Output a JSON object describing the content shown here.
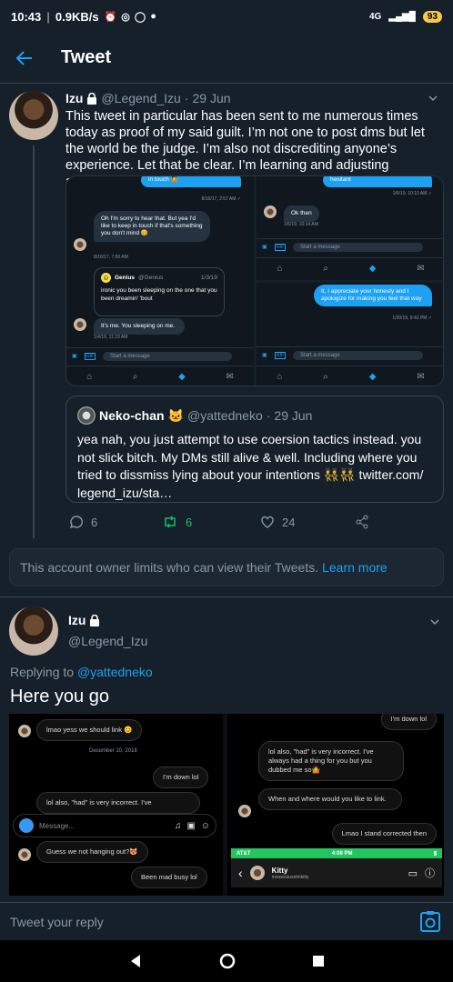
{
  "status_bar": {
    "time": "10:43",
    "speed": "0.9KB/s",
    "battery": "93",
    "network": "4G"
  },
  "app_bar": {
    "title": "Tweet"
  },
  "tweet": {
    "name": "Izu",
    "handle": "@Legend_Izu",
    "dot": "·",
    "date": "29 Jun",
    "text": "This tweet in particular has been sent to me numerous times today as proof of my said guilt. I’m not one to post dms but let the world be the judge. I’m also not discrediting anyone’s experience. Let that be clear. I’m learning and adjusting accordingly",
    "media": {
      "panel1": {
        "bubble_top": "in touch 🤷",
        "time1": "8/16/17, 2:57 AM ✓",
        "gray1": "Oh I'm sorry to hear that. But yea I'd like to keep in touch if that's something you don't mind 😊",
        "time2": "8/16/17, 7:50 AM",
        "genius_name": "Genius",
        "genius_handle": "@Genius",
        "genius_date": "1/3/19",
        "genius_text": "ironic you been sleeping on the one that you been dreamin' 'bout",
        "gray2": "It's me. You sleeping on me.",
        "time3": "1/4/19, 11:23 AM",
        "compose": "Start a message"
      },
      "panel2": {
        "bubble_top": "hesitant",
        "time1": "1/6/19, 10:10 AM ✓",
        "gray1": "Ok then",
        "time2": "1/6/19, 10:14 AM",
        "compose": "Start a message"
      },
      "panel3": {
        "blue": "It, I appreciate your honesty and I apologize for making you feel that way",
        "time1": "1/20/19, 8:42 PM ✓",
        "compose": "Start a message"
      }
    },
    "quote": {
      "name": "Neko-chan",
      "emoji": "🐱",
      "handle": "@yattedneko",
      "dot": "·",
      "date": "29 Jun",
      "text": "yea nah, you just attempt to use coersion tactics instead. you not slick bitch. My DMs still alive & well. Including where you tried to dissmiss lying about your intentions 👯👯 twitter.com/ legend_izu/sta…"
    },
    "actions": {
      "replies": "6",
      "retweets": "6",
      "likes": "24"
    }
  },
  "notice": {
    "text": "This account owner limits who can view their Tweets.",
    "link": "Learn more"
  },
  "reply_tweet": {
    "name": "Izu",
    "handle": "@Legend_Izu",
    "replying_prefix": "Replying to",
    "replying_to": "@yattedneko",
    "text": "Here you go",
    "media": {
      "left": {
        "msg1": "lmao yess we should link 😊",
        "date": "December 10, 2018",
        "msg2": "I'm down lol",
        "msg3": "lol also, \"had\" is very incorrect. I've",
        "compose": "Message...",
        "msg4": "Guess we not hanging out?😻",
        "msg5": "Been mad busy lol"
      },
      "right": {
        "msg1": "I'm down lol",
        "msg2": "lol also, \"had\" is very incorrect. I've always had a thing for you but you dubbed me so🤷",
        "msg3": "When and where would you like to link.",
        "msg4": "Lmao I stand corrected then",
        "carrier": "AT&T",
        "time": "4:08 PM",
        "contact_name": "Kitty",
        "contact_handle": "meowcauseimkitty"
      }
    }
  },
  "reply_bar": {
    "placeholder": "Tweet your reply"
  },
  "colors": {
    "accent": "#1da1f2",
    "background": "#15202b",
    "border": "#38444d",
    "muted": "#8899a6",
    "retweet": "#17bf63"
  }
}
